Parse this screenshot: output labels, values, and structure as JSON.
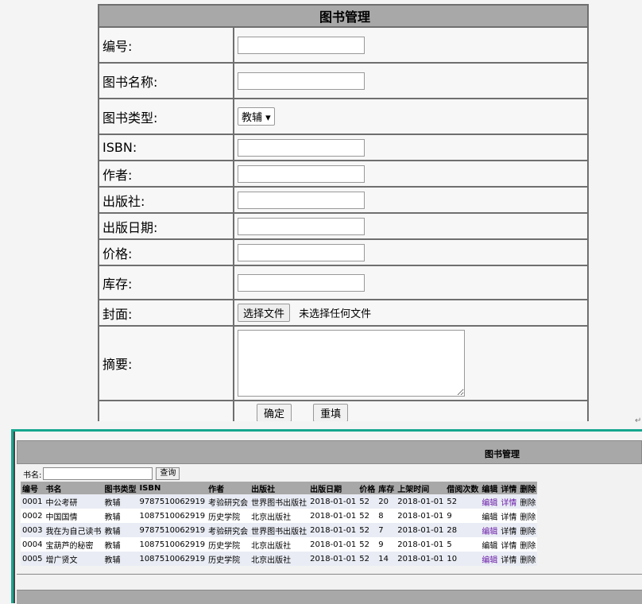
{
  "form": {
    "title": "图书管理",
    "fields": {
      "id_label": "编号:",
      "name_label": "图书名称:",
      "type_label": "图书类型:",
      "type_value": "教辅 ▾",
      "isbn_label": "ISBN:",
      "author_label": "作者:",
      "publisher_label": "出版社:",
      "pubdate_label": "出版日期:",
      "price_label": "价格:",
      "stock_label": "库存:",
      "cover_label": "封面:",
      "cover_button": "选择文件",
      "cover_status": "未选择任何文件",
      "summary_label": "摘要:"
    },
    "buttons": {
      "confirm": "确定",
      "reset": "重填"
    }
  },
  "separator": {
    "return_mark": "↵"
  },
  "list": {
    "title": "图书管理",
    "search": {
      "label": "书名:",
      "button": "查询"
    },
    "columns": [
      "编号",
      "书名",
      "图书类型",
      "ISBN",
      "作者",
      "出版社",
      "出版日期",
      "价格",
      "库存",
      "上架时间",
      "借阅次数",
      "编辑",
      "详情",
      "删除"
    ],
    "rows": [
      [
        "0001",
        "中公考研",
        "教辅",
        "9787510062919",
        "考验研究会",
        "世界图书出版社",
        "2018-01-01",
        "52",
        "20",
        "2018-01-01",
        "52",
        "编辑",
        "详情",
        "删除"
      ],
      [
        "0002",
        "中国国情",
        "教辅",
        "1087510062919",
        "历史学院",
        "北京出版社",
        "2018-01-01",
        "52",
        "8",
        "2018-01-01",
        "9",
        "编辑",
        "详情",
        "删除"
      ],
      [
        "0003",
        "我在为自己读书",
        "教辅",
        "9787510062919",
        "考验研究会",
        "世界图书出版社",
        "2018-01-01",
        "52",
        "7",
        "2018-01-01",
        "28",
        "编辑",
        "详情",
        "删除"
      ],
      [
        "0004",
        "宝葫芦的秘密",
        "教辅",
        "1087510062919",
        "历史学院",
        "北京出版社",
        "2018-01-01",
        "52",
        "9",
        "2018-01-01",
        "5",
        "编辑",
        "详情",
        "删除"
      ],
      [
        "0005",
        "增广贤文",
        "教辅",
        "1087510062919",
        "历史学院",
        "北京出版社",
        "2018-01-01",
        "52",
        "14",
        "2018-01-01",
        "10",
        "编辑",
        "详情",
        "删除"
      ]
    ]
  }
}
